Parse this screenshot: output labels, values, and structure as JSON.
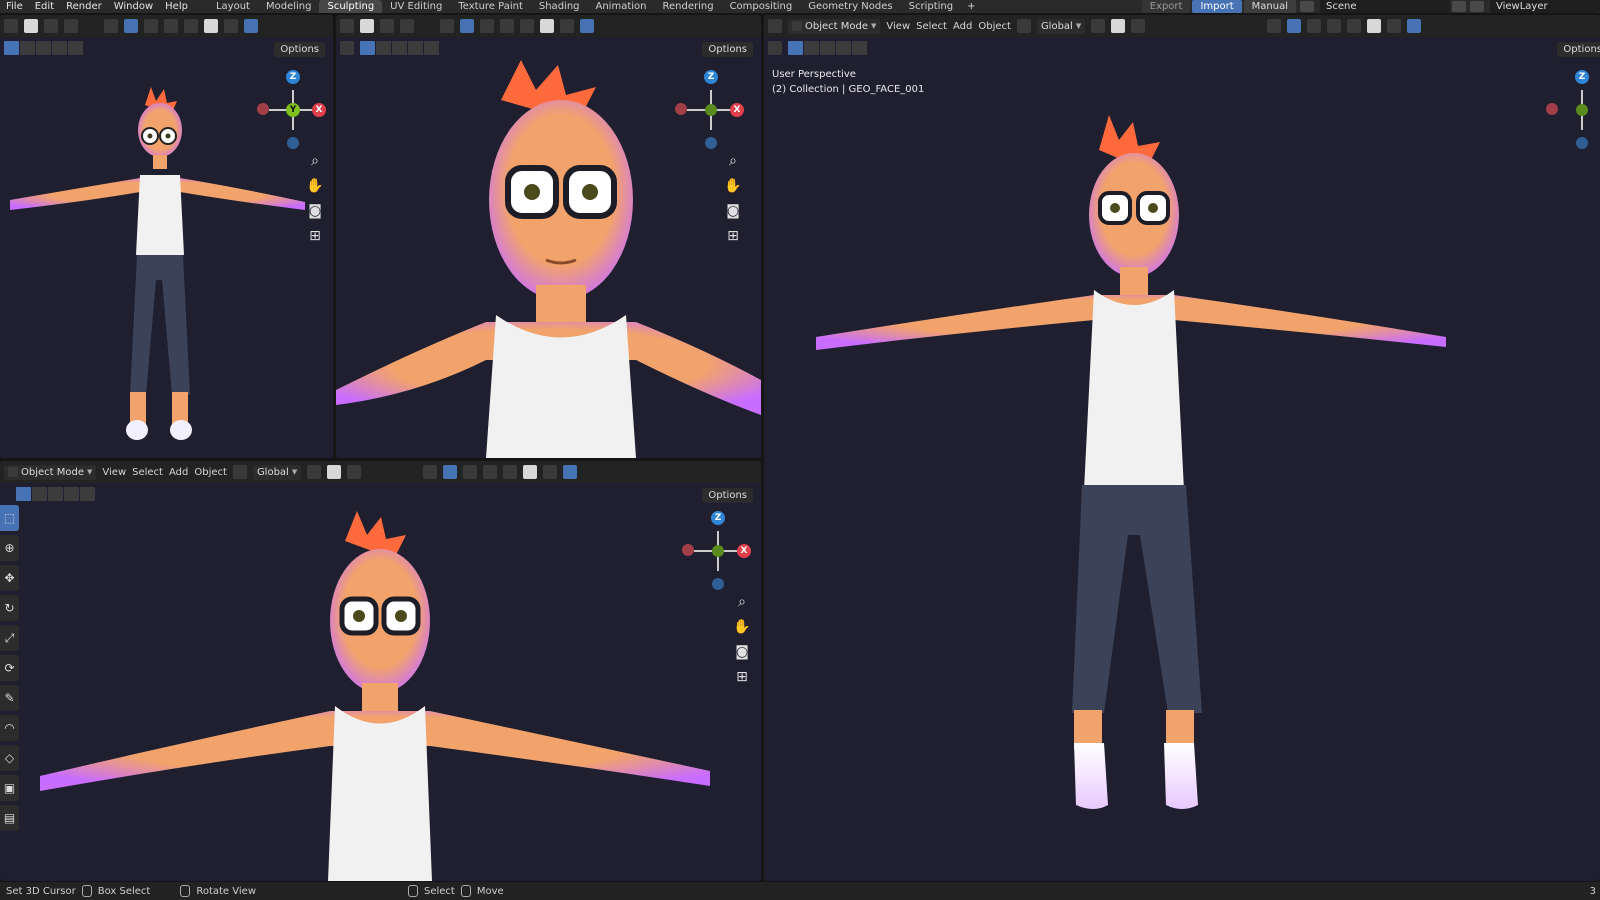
{
  "topbar": {
    "menus": [
      "File",
      "Edit",
      "Render",
      "Window",
      "Help"
    ],
    "workspaces": [
      "Layout",
      "Modeling",
      "Sculpting",
      "UV Editing",
      "Texture Paint",
      "Shading",
      "Animation",
      "Rendering",
      "Compositing",
      "Geometry Nodes",
      "Scripting"
    ],
    "active_workspace": "Sculpting",
    "add_label": "+",
    "export_label": "Export",
    "import_label": "Import",
    "manual_label": "Manual",
    "scene_label": "Scene",
    "viewlayer_label": "ViewLayer"
  },
  "viewport_top_left": {
    "options_label": "Options"
  },
  "viewport_top_mid": {
    "options_label": "Options"
  },
  "viewport_bottom": {
    "mode_label": "Object Mode",
    "menu": [
      "View",
      "Select",
      "Add",
      "Object"
    ],
    "orientation_label": "Global",
    "options_label": "Options"
  },
  "viewport_right": {
    "mode_label": "Object Mode",
    "menu": [
      "View",
      "Select",
      "Add",
      "Object"
    ],
    "orientation_label": "Global",
    "options_label": "Options",
    "perspective_label": "User Perspective",
    "collection_label": "(2) Collection | GEO_FACE_001"
  },
  "gizmo": {
    "z": "Z",
    "x": "X",
    "y": "Y"
  },
  "statusbar": {
    "items": [
      "Set 3D Cursor",
      "Box Select",
      "Rotate View",
      "Select",
      "Move"
    ],
    "right_value": "3"
  },
  "colors": {
    "viewport_bg": "#1f1f30",
    "header_bg": "#232323",
    "accent": "#4772b3",
    "skin": "#f2a36b",
    "hair": "#ff6a3d",
    "pants": "#3c4257",
    "shirt": "#f1f1f1"
  }
}
